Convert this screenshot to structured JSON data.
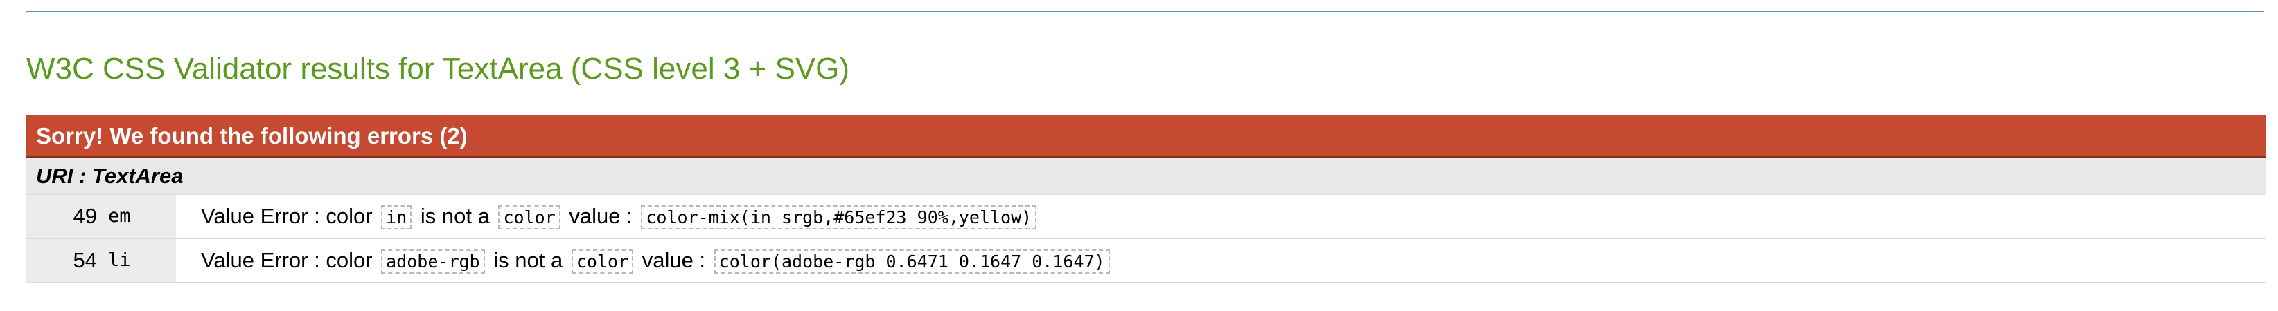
{
  "title": "W3C CSS Validator results for TextArea (CSS level 3 + SVG)",
  "errors": {
    "heading": "Sorry! We found the following errors (2)",
    "uri_label": "URI : TextArea",
    "rows": [
      {
        "line": "49",
        "context": "em",
        "msg_prefix": "Value Error : color",
        "value_token": "in",
        "msg_middle": "is not a",
        "type_token": "color",
        "msg_value": "value :",
        "full_value": "color-mix(in srgb,#65ef23 90%,yellow)"
      },
      {
        "line": "54",
        "context": "li",
        "msg_prefix": "Value Error : color",
        "value_token": "adobe-rgb",
        "msg_middle": "is not a",
        "type_token": "color",
        "msg_value": "value :",
        "full_value": "color(adobe-rgb 0.6471 0.1647 0.1647)"
      }
    ]
  },
  "colors": {
    "title": "#5b9a1e",
    "error_header_bg": "#c64931",
    "uri_bg": "#e8e8e8",
    "top_rule": "#6a8fb4"
  }
}
